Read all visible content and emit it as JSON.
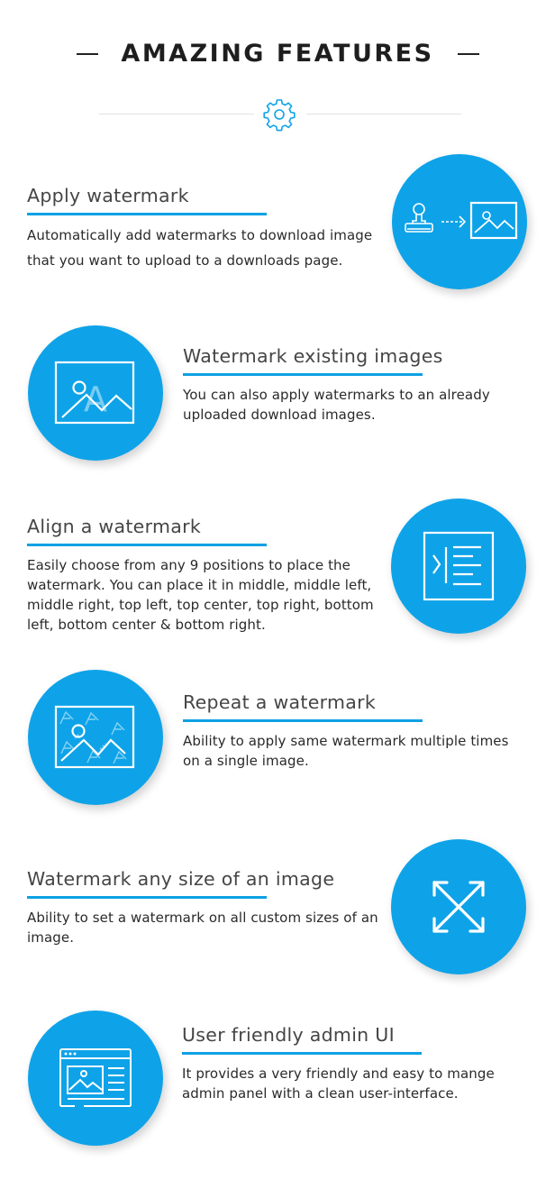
{
  "header": {
    "title": "AMAZING FEATURES",
    "icon": "gear-icon"
  },
  "colors": {
    "accent": "#0ea3e8",
    "underline": "#0ea1e4",
    "title": "#1e1e1e",
    "heading": "#454545",
    "body": "#2a2a2a"
  },
  "features": [
    {
      "title": "Apply watermark",
      "description": "Automatically add watermarks to download image that you want to upload to a downloads page.",
      "icon": "stamp-to-image-icon"
    },
    {
      "title": "Watermark existing images",
      "description": "You can also apply watermarks to an already uploaded download images.",
      "icon": "image-watermark-icon"
    },
    {
      "title": "Align a watermark",
      "description": "Easily choose from any 9 positions to place the watermark. You can place it in middle, middle left, middle right, top left, top center, top right, bottom left, bottom center & bottom right.",
      "icon": "align-indent-icon"
    },
    {
      "title": "Repeat a watermark",
      "description": "Ability to apply same watermark multiple times on a single image.",
      "icon": "repeat-watermark-image-icon"
    },
    {
      "title": "Watermark any size of an image",
      "description": "Ability to set a watermark on all custom sizes of an image.",
      "icon": "expand-arrows-icon"
    },
    {
      "title": "User friendly admin UI",
      "description": "It provides a very friendly and easy to mange admin panel with a clean user-interface.",
      "icon": "admin-window-icon"
    }
  ]
}
